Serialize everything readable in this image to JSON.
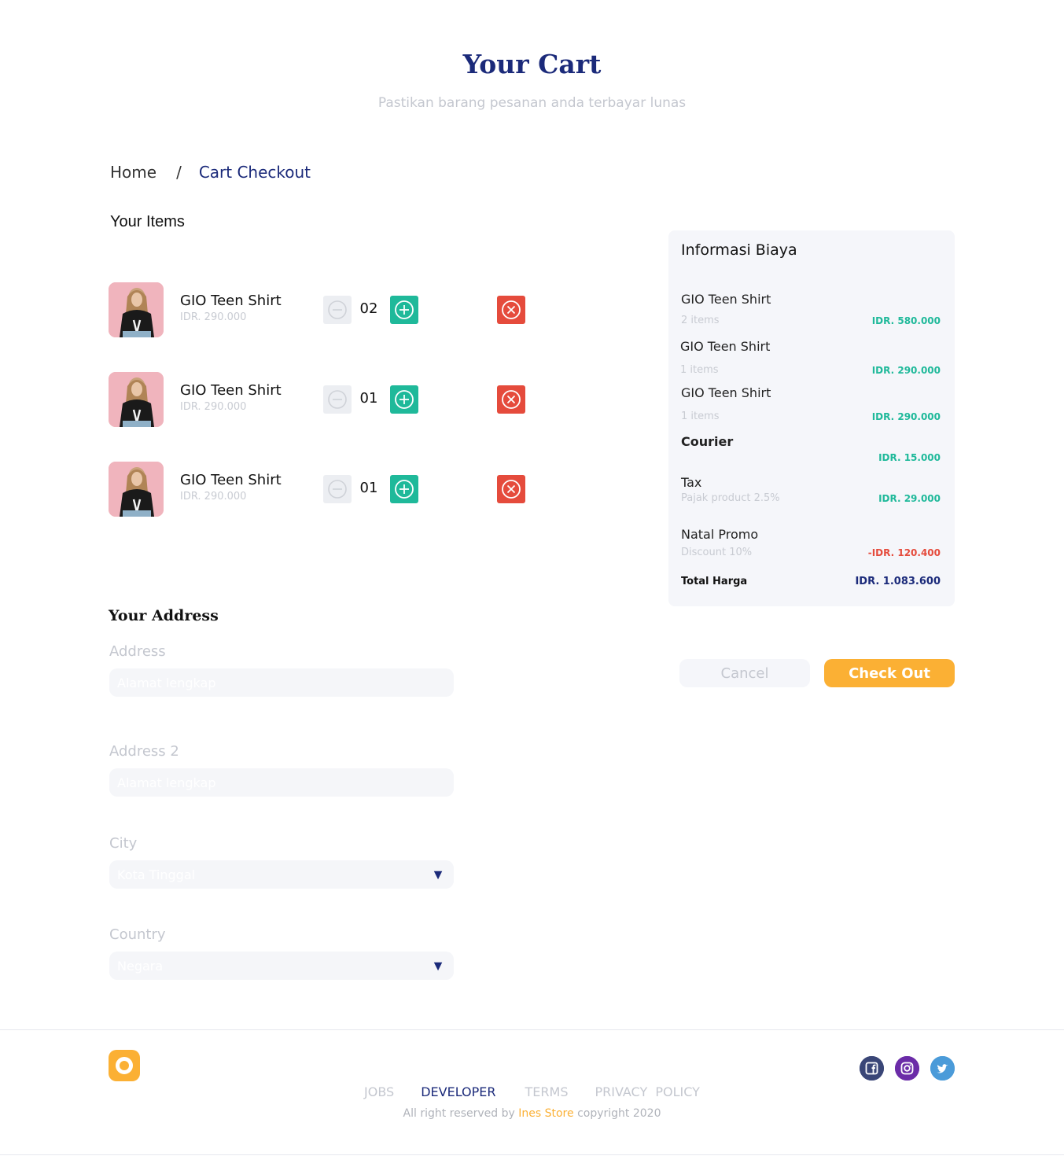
{
  "header": {
    "title": "Your Cart",
    "subtitle": "Pastikan barang pesanan anda terbayar lunas"
  },
  "breadcrumb": {
    "home": "Home",
    "separator": "/",
    "current": "Cart Checkout"
  },
  "items_section": {
    "title": "Your Items",
    "items": [
      {
        "name": "GIO Teen Shirt",
        "price": "IDR. 290.000",
        "qty": "02"
      },
      {
        "name": "GIO Teen Shirt",
        "price": "IDR. 290.000",
        "qty": "01"
      },
      {
        "name": "GIO Teen Shirt",
        "price": "IDR. 290.000",
        "qty": "01"
      }
    ],
    "icons": {
      "minus": "minus-circle-icon",
      "plus": "plus-circle-icon",
      "remove": "close-circle-icon"
    }
  },
  "address_section": {
    "title": "Your Address",
    "address_label": "Address",
    "address_placeholder": "Alamat lengkap",
    "address2_label": "Address 2",
    "address2_placeholder": "Alamat lengkap",
    "city_label": "City",
    "city_placeholder": "Kota Tinggal",
    "country_label": "Country",
    "country_placeholder": "Negara",
    "dropdown_arrow": "▼"
  },
  "summary": {
    "title": "Informasi Biaya",
    "lines": [
      {
        "name": "GIO Teen Shirt",
        "sub": "2 items",
        "value": "IDR. 580.000"
      },
      {
        "name": "GIO Teen Shirt",
        "sub": "1 items",
        "value": "IDR. 290.000"
      },
      {
        "name": "GIO Teen Shirt",
        "sub": "1 items",
        "value": "IDR. 290.000"
      }
    ],
    "courier": {
      "name": "Courier",
      "value": "IDR. 15.000"
    },
    "tax": {
      "name": "Tax",
      "sub": "Pajak product 2.5%",
      "value": "IDR. 29.000"
    },
    "promo": {
      "name": "Natal Promo",
      "sub": "Discount 10%",
      "value": "-IDR. 120.400"
    },
    "total": {
      "label": "Total Harga",
      "value": "IDR. 1.083.600"
    }
  },
  "actions": {
    "cancel": "Cancel",
    "checkout": "Check Out"
  },
  "footer": {
    "nav": [
      "JOBS",
      "DEVELOPER",
      "TERMS",
      "PRIVACY  POLICY"
    ],
    "copy_prefix": "All right reserved by ",
    "brand": "Ines Store",
    "copy_suffix": " copyright 2020",
    "social": [
      "facebook-icon",
      "instagram-icon",
      "twitter-icon"
    ]
  },
  "colors": {
    "primary": "#1b2a7a",
    "accent": "#fbb034",
    "green": "#1fb99a",
    "red": "#e54b3c"
  }
}
